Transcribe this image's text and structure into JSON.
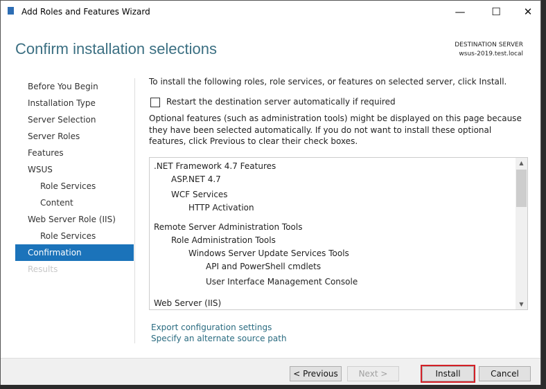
{
  "window": {
    "title": "Add Roles and Features Wizard",
    "minimize": "—",
    "maximize": "☐",
    "close": "✕"
  },
  "header": {
    "title": "Confirm installation selections",
    "dest_label": "DESTINATION SERVER",
    "dest_server": "wsus-2019.test.local"
  },
  "sidebar": {
    "items": [
      {
        "label": "Before You Begin"
      },
      {
        "label": "Installation Type"
      },
      {
        "label": "Server Selection"
      },
      {
        "label": "Server Roles"
      },
      {
        "label": "Features"
      },
      {
        "label": "WSUS"
      },
      {
        "label": "Role Services"
      },
      {
        "label": "Content"
      },
      {
        "label": "Web Server Role (IIS)"
      },
      {
        "label": "Role Services"
      },
      {
        "label": "Confirmation"
      },
      {
        "label": "Results"
      }
    ]
  },
  "main": {
    "intro": "To install the following roles, role services, or features on selected server, click Install.",
    "restart_label": "Restart the destination server automatically if required",
    "restart_checked": false,
    "optional_note": "Optional features (such as administration tools) might be displayed on this page because they have been selected automatically. If you do not want to install these optional features, click Previous to clear their check boxes.",
    "features": [
      ".NET Framework 4.7 Features",
      "ASP.NET 4.7",
      "WCF Services",
      "HTTP Activation",
      "Remote Server Administration Tools",
      "Role Administration Tools",
      "Windows Server Update Services Tools",
      "API and PowerShell cmdlets",
      "User Interface Management Console",
      "Web Server (IIS)"
    ],
    "export_link": "Export configuration settings",
    "alt_source_link": "Specify an alternate source path"
  },
  "footer": {
    "previous": "< Previous",
    "next": "Next >",
    "install": "Install",
    "cancel": "Cancel"
  },
  "colors": {
    "accent": "#1b73ba",
    "highlight": "#d42027",
    "title": "#3b6f82"
  }
}
